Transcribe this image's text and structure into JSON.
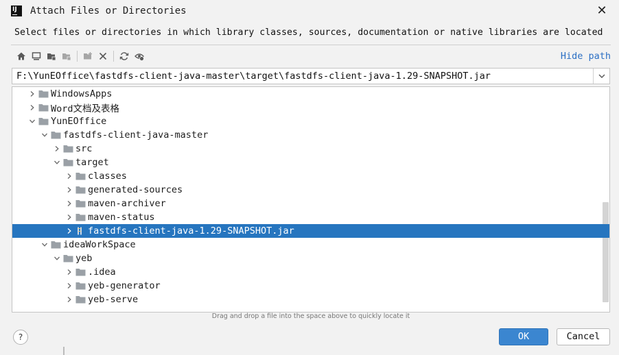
{
  "window": {
    "title": "Attach Files or Directories",
    "app_icon_text": "IJ",
    "close_glyph": "✕"
  },
  "description": "Select files or directories in which library classes, sources, documentation or native libraries are located",
  "toolbar": {
    "icons": [
      "home-icon",
      "desktop-icon",
      "project-folder-icon",
      "module-folder-icon",
      "new-folder-icon",
      "delete-icon",
      "refresh-icon",
      "show-hidden-icon"
    ],
    "hide_path_label": "Hide path"
  },
  "path": {
    "value": "F:\\YunEOffice\\fastdfs-client-java-master\\target\\fastdfs-client-java-1.29-SNAPSHOT.jar"
  },
  "tree": {
    "rows": [
      {
        "label": "WindowsApps",
        "depth": 1,
        "expanded": false,
        "kind": "folder"
      },
      {
        "label": "Word文档及表格",
        "depth": 1,
        "expanded": false,
        "kind": "folder"
      },
      {
        "label": "YunEOffice",
        "depth": 1,
        "expanded": true,
        "kind": "folder"
      },
      {
        "label": "fastdfs-client-java-master",
        "depth": 2,
        "expanded": true,
        "kind": "folder"
      },
      {
        "label": "src",
        "depth": 3,
        "expanded": false,
        "kind": "folder"
      },
      {
        "label": "target",
        "depth": 3,
        "expanded": true,
        "kind": "folder"
      },
      {
        "label": "classes",
        "depth": 4,
        "expanded": false,
        "kind": "folder"
      },
      {
        "label": "generated-sources",
        "depth": 4,
        "expanded": false,
        "kind": "folder"
      },
      {
        "label": "maven-archiver",
        "depth": 4,
        "expanded": false,
        "kind": "folder"
      },
      {
        "label": "maven-status",
        "depth": 4,
        "expanded": false,
        "kind": "folder"
      },
      {
        "label": "fastdfs-client-java-1.29-SNAPSHOT.jar",
        "depth": 4,
        "expanded": false,
        "kind": "jar",
        "selected": true
      },
      {
        "label": "ideaWorkSpace",
        "depth": 2,
        "expanded": true,
        "kind": "folder"
      },
      {
        "label": "yeb",
        "depth": 3,
        "expanded": true,
        "kind": "folder"
      },
      {
        "label": ".idea",
        "depth": 4,
        "expanded": false,
        "kind": "folder"
      },
      {
        "label": "yeb-generator",
        "depth": 4,
        "expanded": false,
        "kind": "folder"
      },
      {
        "label": "yeb-serve",
        "depth": 4,
        "expanded": false,
        "kind": "folder"
      }
    ]
  },
  "hint": "Drag and drop a file into the space above to quickly locate it",
  "buttons": {
    "help": "?",
    "ok": "OK",
    "cancel": "Cancel"
  },
  "colors": {
    "selection": "#2675bf",
    "link": "#2b6fc4",
    "ok_button": "#3b86d0"
  }
}
